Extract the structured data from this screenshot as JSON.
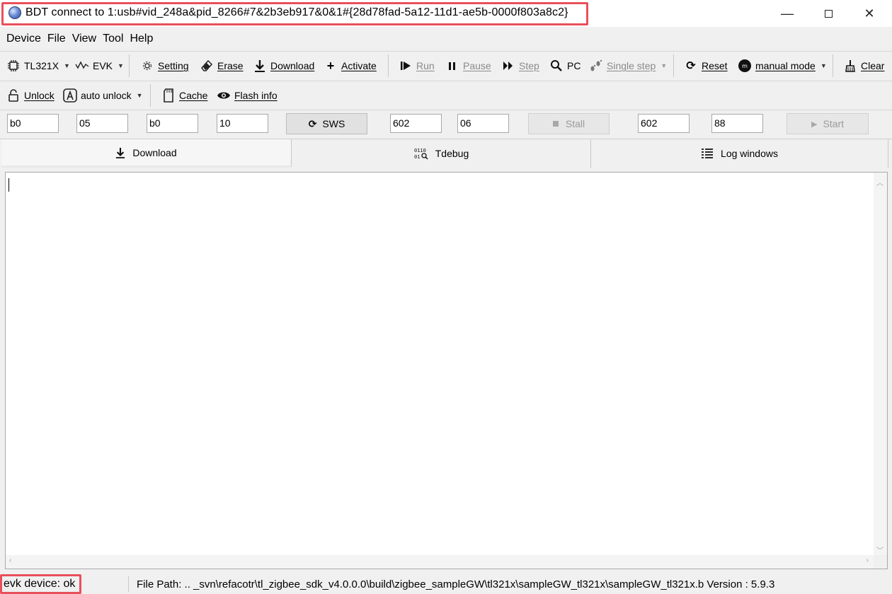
{
  "window": {
    "title": "BDT connect to 1:usb#vid_248a&pid_8266#7&2b3eb917&0&1#{28d78fad-5a12-11d1-ae5b-0000f803a8c2}",
    "controls": {
      "minimize": "—",
      "close": "✕"
    }
  },
  "menu": [
    "Device",
    "File",
    "View",
    "Tool",
    "Help"
  ],
  "toolbar1": {
    "chip": "TL321X",
    "board": "EVK",
    "setting": "Setting",
    "erase": "Erase",
    "download": "Download",
    "activate": "Activate",
    "run": "Run",
    "pause": "Pause",
    "step": "Step",
    "pc": "PC",
    "single_step": "Single step",
    "reset": "Reset",
    "mode": "manual mode",
    "clear": "Clear"
  },
  "toolbar2": {
    "unlock": "Unlock",
    "auto_unlock": "auto unlock",
    "cache": "Cache",
    "flash_info": "Flash info"
  },
  "inputs": {
    "f1": "b0",
    "f2": "05",
    "f3": "b0",
    "f4": "10",
    "sws": "SWS",
    "f5": "602",
    "f6": "06",
    "stall": "Stall",
    "f7": "602",
    "f8": "88",
    "start": "Start"
  },
  "tabs": [
    "Download",
    "Tdebug",
    "Log windows"
  ],
  "status": {
    "device": "evk device: ok",
    "file_path": "File Path:   ..  _svn\\refacotr\\tl_zigbee_sdk_v4.0.0.0\\build\\zigbee_sampleGW\\tl321x\\sampleGW_tl321x\\sampleGW_tl321x.b Version : 5.9.3"
  },
  "colors": {
    "highlight": "#e8505b",
    "accent": "#2c4a9a"
  }
}
